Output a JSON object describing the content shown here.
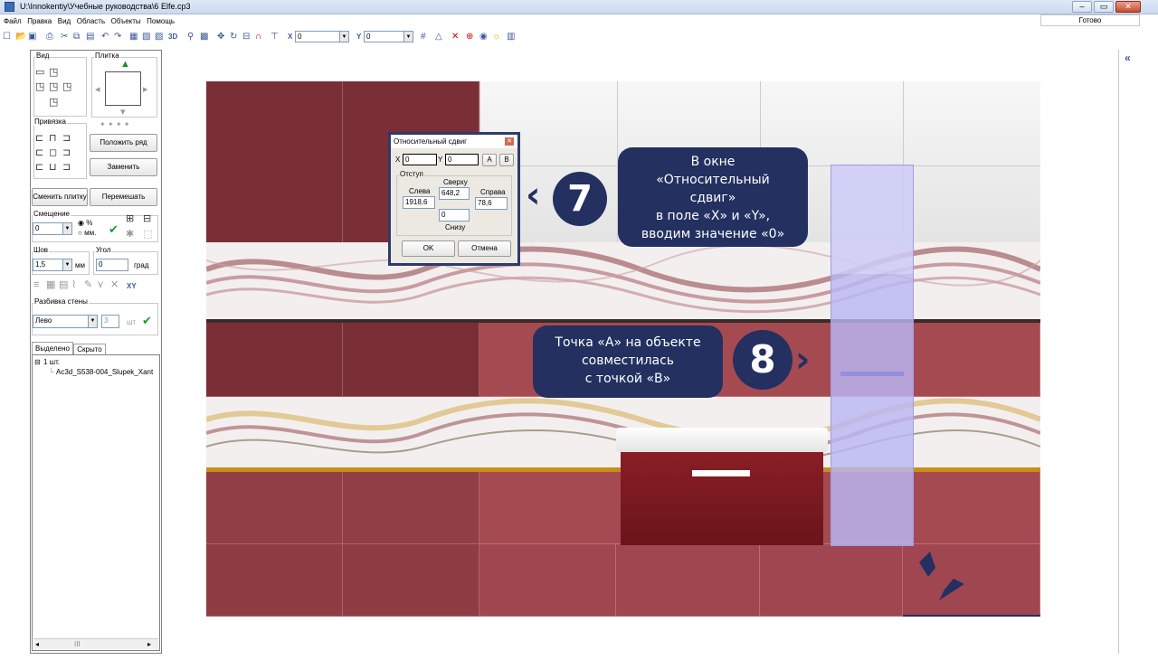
{
  "window": {
    "title": "U:\\Innokentiy\\Учебные руководства\\6 Elfe.cp3",
    "min": "–",
    "max": "▭",
    "close": "✕"
  },
  "menu": [
    "Файл",
    "Правка",
    "Вид",
    "Область",
    "Объекты",
    "Помощь"
  ],
  "status": "Готово",
  "toolbar": {
    "x_label": "X",
    "x_value": "0",
    "y_label": "Y",
    "y_value": "0",
    "btn_3d": "3D"
  },
  "panel": {
    "view_label": "Вид",
    "tile_label": "Плитка",
    "snap_label": "Привязка",
    "lay_row": "Положить ряд",
    "replace": "Заменить",
    "change_tile": "Сменить плитку",
    "shuffle": "Перемешать",
    "offset_label": "Смещение",
    "offset_value": "0",
    "unit_percent": "%",
    "unit_mm": "мм.",
    "seam_label": "Шов",
    "seam_value": "1,5",
    "seam_unit": "мм",
    "angle_label": "Угол",
    "angle_value": "0",
    "angle_unit": "град",
    "xy": "XY",
    "wall_split_label": "Разбивка стены",
    "wall_split_value": "Лево",
    "count_value": "3",
    "count_unit": "шт",
    "tab_selected": "Выделено",
    "tab_hidden": "Скрыто",
    "tree_root": "1 шт.",
    "tree_item": "Ac3d_S538-004_Slupek_Xant",
    "scroll_mark": "III"
  },
  "right_strip": {
    "collapse": "«"
  },
  "dialog": {
    "title": "Относительный сдвиг",
    "x_label": "X",
    "x_value": "0",
    "y_label": "Y",
    "y_value": "0",
    "btn_a": "A",
    "btn_b": "B",
    "indent_label": "Отступ",
    "left_label": "Слева",
    "left_value": "1918,6",
    "top_label": "Сверху",
    "top_value": "648,2",
    "right_label": "Справа",
    "right_value": "78,6",
    "bottom_value": "0",
    "bottom_label": "Снизу",
    "ok": "OK",
    "cancel": "Отмена"
  },
  "callouts": {
    "step7_number": "7",
    "step7_lines": [
      "В окне",
      "«Относительный",
      "сдвиг»",
      "в поле «X» и «Y»,",
      "вводим значение «0»"
    ],
    "step8_number": "8",
    "step8_lines": [
      "Точка «А» на объекте",
      "совместилась",
      "с точкой «В»"
    ]
  },
  "colors": {
    "callout_bg": "#233060",
    "tile_red": "#8a3a40",
    "tile_white": "#e8e8e8",
    "column_overlay": "#b9b7f4"
  }
}
